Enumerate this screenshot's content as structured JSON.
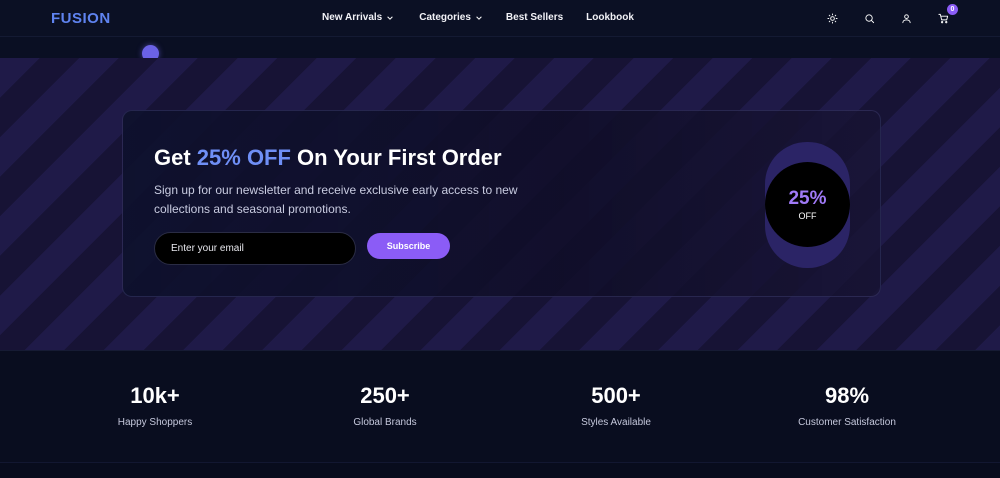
{
  "brand": {
    "logo_text": "FUSION"
  },
  "nav": {
    "links": [
      {
        "label": "New Arrivals",
        "has_dropdown": true
      },
      {
        "label": "Categories",
        "has_dropdown": true
      },
      {
        "label": "Best Sellers",
        "has_dropdown": false
      },
      {
        "label": "Lookbook",
        "has_dropdown": false
      }
    ],
    "icons": [
      "sun-icon",
      "search-icon",
      "user-icon",
      "cart-icon"
    ],
    "cart_count": "0"
  },
  "promo": {
    "title_prefix": "Get ",
    "title_accent": "25% OFF",
    "title_suffix": " On Your First Order",
    "description": "Sign up for our newsletter and receive exclusive early access to new collections and seasonal promotions.",
    "email_placeholder": "Enter your email",
    "subscribe_label": "Subscribe",
    "badge_value": "25%",
    "badge_label": "OFF"
  },
  "stats": [
    {
      "value": "10k+",
      "label": "Happy Shoppers"
    },
    {
      "value": "250+",
      "label": "Global Brands"
    },
    {
      "value": "500+",
      "label": "Styles Available"
    },
    {
      "value": "98%",
      "label": "Customer Satisfaction"
    }
  ],
  "colors": {
    "accent": "#8b5cf6",
    "logo": "#5f83f0",
    "title_accent": "#6f8ff6",
    "background": "#080c1d"
  }
}
